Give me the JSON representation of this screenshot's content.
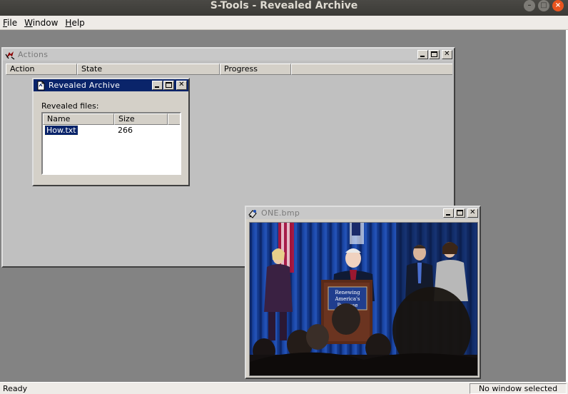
{
  "os": {
    "window_title": "S-Tools - Revealed Archive",
    "controls": [
      "minimize",
      "maximize",
      "close"
    ]
  },
  "menu": [
    {
      "label": "File",
      "accel": "F",
      "rest": "ile"
    },
    {
      "label": "Window",
      "accel": "W",
      "rest": "indow"
    },
    {
      "label": "Help",
      "accel": "H",
      "rest": "elp"
    }
  ],
  "actions_window": {
    "title": "Actions",
    "columns": [
      "Action",
      "State",
      "Progress"
    ]
  },
  "revealed_window": {
    "title": "Revealed Archive",
    "label": "Revealed files:",
    "columns": [
      "Name",
      "Size"
    ],
    "rows": [
      {
        "name": "How.txt",
        "size": "266"
      }
    ]
  },
  "image_window": {
    "title": "ONE.bmp",
    "podium_text": [
      "Renewing",
      "America's",
      "Purpose"
    ]
  },
  "status": {
    "left": "Ready",
    "right": "No window selected"
  },
  "colors": {
    "active_title": "#0a246a",
    "mdi_background": "#838383",
    "os_close": "#e9541f"
  }
}
